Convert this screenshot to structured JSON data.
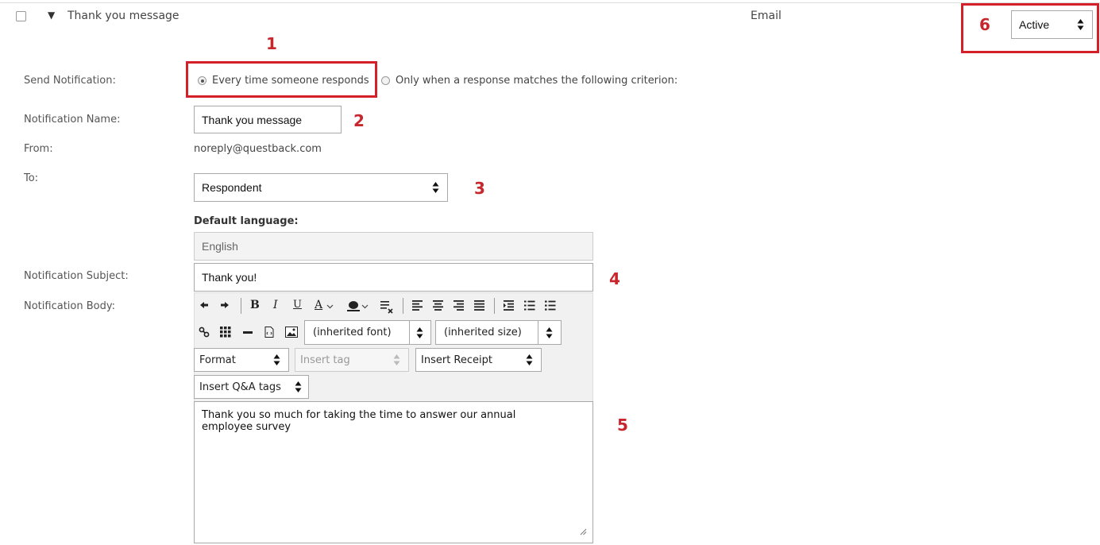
{
  "header": {
    "title": "Thank you message",
    "expand_glyph": "▼",
    "channel": "Email",
    "status_value": "Active"
  },
  "annotations": [
    "1",
    "2",
    "3",
    "4",
    "5",
    "6"
  ],
  "form": {
    "send_notification": {
      "label": "Send Notification:",
      "option_every": "Every time someone responds",
      "option_match": "Only when a response matches the following criterion:"
    },
    "notification_name": {
      "label": "Notification Name:",
      "value": "Thank you message"
    },
    "from": {
      "label": "From:",
      "value": "noreply@questback.com"
    },
    "to": {
      "label": "To:",
      "value": "Respondent"
    },
    "default_language": {
      "label": "Default language:",
      "value": "English"
    },
    "subject": {
      "label": "Notification Subject:",
      "value": "Thank you!"
    },
    "body": {
      "label": "Notification Body:",
      "text": "Thank you so much for taking the time to answer our annual employee survey"
    }
  },
  "editor": {
    "font_select": "(inherited font)",
    "size_select": "(inherited size)",
    "format_select": "Format",
    "insert_tag_select": "Insert tag",
    "insert_receipt_select": "Insert Receipt",
    "insert_qa_select": "Insert Q&A tags",
    "icons": [
      "undo-icon",
      "redo-icon",
      "bold-icon",
      "italic-icon",
      "underline-icon",
      "text-color-icon",
      "highlight-icon",
      "clear-format-icon",
      "align-left-icon",
      "align-center-icon",
      "align-right-icon",
      "justify-icon",
      "indent-icon",
      "ordered-list-icon",
      "bullet-list-icon",
      "link-icon",
      "table-icon",
      "horizontal-rule-icon",
      "source-icon",
      "image-icon"
    ],
    "glyphs": {
      "bold": "B",
      "italic": "I",
      "underline": "U",
      "text_color": "A"
    }
  },
  "colors": {
    "annotation": "#c8262d",
    "border": "#a9a9a9"
  }
}
